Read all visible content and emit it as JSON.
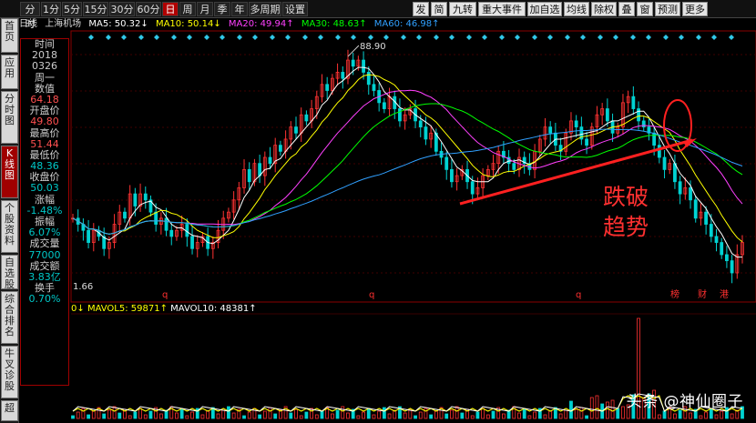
{
  "toolbar": {
    "period_tabs": [
      "分时",
      "1分",
      "5分",
      "15分",
      "30分",
      "60分",
      "日",
      "周",
      "月",
      "季",
      "年",
      "多周期",
      "设置"
    ],
    "active_period": "日",
    "right_buttons": [
      "发",
      "简",
      "九转",
      "重大事件",
      "加自选",
      "均线",
      "除权",
      "叠",
      "窗",
      "预测",
      "更多"
    ]
  },
  "left_tabs": [
    "首页",
    "应用",
    "分时图",
    "K线图",
    "个股资料",
    "自选股",
    "综合排名",
    "牛叉诊股",
    "超"
  ],
  "active_left_tab": "K线图",
  "infobar": {
    "period": "日线",
    "stock": "上海机场",
    "ma5": "MA5: 50.32↓",
    "ma10": "MA10: 50.14↓",
    "ma20": "MA20: 49.94↑",
    "ma30": "MA30: 48.63↑",
    "ma60": "MA60: 46.98↑"
  },
  "data_window": {
    "rows": [
      {
        "label": "时间",
        "value": "2018"
      },
      {
        "label": "",
        "value": "0326"
      },
      {
        "label": "周一",
        "value": ""
      },
      {
        "label": "数值",
        "value": "64.18"
      },
      {
        "label": "开盘价",
        "value": "49.80"
      },
      {
        "label": "最高价",
        "value": "51.44"
      },
      {
        "label": "最低价",
        "value": "48.36"
      },
      {
        "label": "收盘价",
        "value": "50.03"
      },
      {
        "label": "涨幅",
        "value": "-1.48%"
      },
      {
        "label": "振幅",
        "value": "6.07%"
      },
      {
        "label": "成交量",
        "value": "77000"
      },
      {
        "label": "成交额",
        "value": "3.83亿"
      },
      {
        "label": "换手",
        "value": "0.70%"
      }
    ]
  },
  "price_labels": {
    "high": "88.90",
    "low": "1.66"
  },
  "event_markers": [
    "q",
    "q",
    "q",
    "榜",
    "财",
    "港"
  ],
  "volume_bar": {
    "prefix": "0↓",
    "mavol5": "MAVOL5: 59871↑",
    "mavol10": "MAVOL10: 48381↑"
  },
  "annotation": {
    "line1": "跌破",
    "line2": "趋势"
  },
  "watermark": "头条 @神仙圈子",
  "colors": {
    "up": "#ff3232",
    "down": "#00d2d2",
    "ma5": "#ffffff",
    "ma10": "#ffff00",
    "ma20": "#ff40ff",
    "ma30": "#00ff00",
    "ma60": "#30a0ff",
    "accent": "#b00000"
  },
  "chart_data": {
    "type": "candlestick",
    "series_close": [
      62,
      61,
      60,
      58,
      60,
      59,
      57,
      58,
      61,
      63,
      62,
      66,
      64,
      66,
      65,
      63,
      61,
      62,
      60,
      59,
      60,
      61,
      59,
      57,
      58,
      59,
      57,
      58,
      60,
      62,
      63,
      65,
      67,
      70,
      68,
      71,
      69,
      72,
      71,
      74,
      73,
      75,
      77,
      76,
      79,
      78,
      80,
      82,
      84,
      83,
      85,
      86,
      85,
      88,
      87,
      88,
      86,
      84,
      83,
      81,
      80,
      82,
      80,
      78,
      79,
      80,
      78,
      77,
      75,
      76,
      73,
      72,
      70,
      68,
      69,
      70,
      68,
      66,
      67,
      69,
      70,
      71,
      73,
      72,
      71,
      70,
      72,
      71,
      70,
      73,
      75,
      77,
      76,
      74,
      73,
      76,
      78,
      77,
      75,
      74,
      77,
      79,
      80,
      78,
      76,
      77,
      81,
      82,
      80,
      78,
      77,
      76,
      74,
      72,
      70,
      71,
      68,
      66,
      67,
      65,
      62,
      63,
      61,
      59,
      58,
      56,
      55,
      53,
      56,
      58
    ],
    "ma60_last": "46.98",
    "volume_note": "volume bars, MAVOL5 59871, MAVOL10 48381"
  }
}
